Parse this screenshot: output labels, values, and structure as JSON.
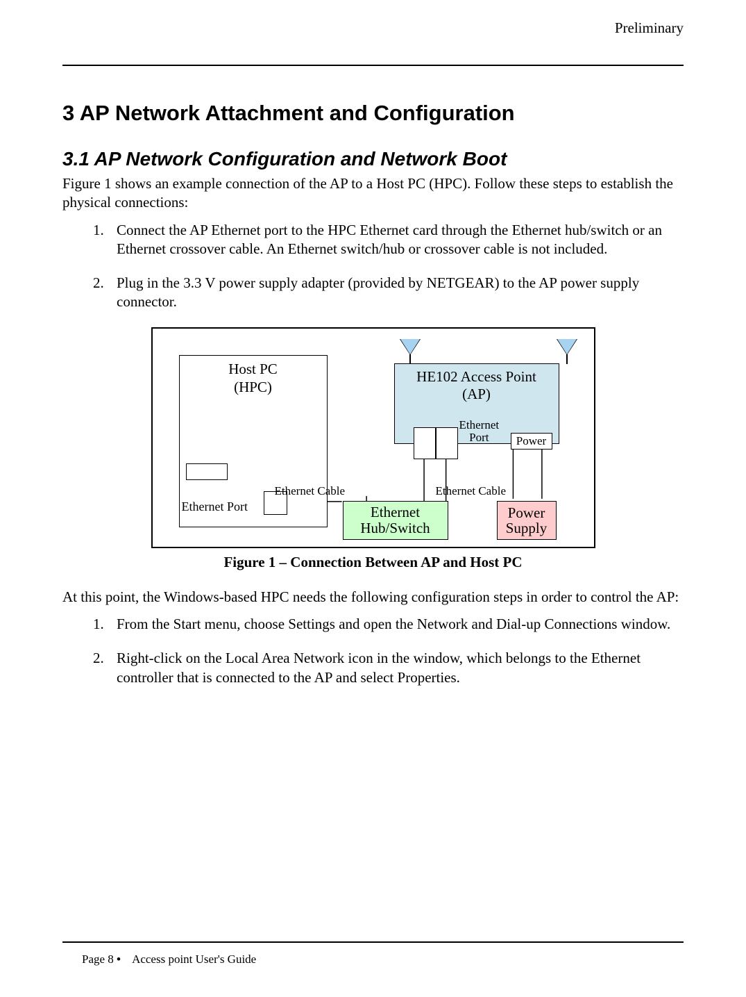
{
  "header": {
    "label": "Preliminary"
  },
  "section": {
    "h1": "3  AP Network Attachment and Configuration",
    "h2": "3.1    AP Network Configuration and Network Boot",
    "intro": "Figure 1 shows an example connection of the AP to a Host PC (HPC).  Follow these steps to establish the physical connections:",
    "steps_a": [
      "Connect the AP Ethernet port to the HPC Ethernet card through the Ethernet hub/switch or an Ethernet crossover cable. An Ethernet switch/hub or crossover cable is not included.",
      "Plug in the 3.3 V power supply adapter (provided by NETGEAR) to the AP power supply connector."
    ],
    "after_fig": "At this point, the Windows-based HPC needs the following configuration steps in order to control the AP:",
    "steps_b": [
      "From the Start menu, choose Settings and open the Network and Dial-up Connections window.",
      "Right-click on the Local Area Network icon in the window, which belongs to the Ethernet controller that is connected to the AP and select Properties."
    ]
  },
  "figure": {
    "hpc_line1": "Host PC",
    "hpc_line2": "(HPC)",
    "hpc_port": "Ethernet Port",
    "ap_line1": "HE102 Access Point",
    "ap_line2": "(AP)",
    "ap_eport_line1": "Ethernet",
    "ap_eport_line2": "Port",
    "ap_power": "Power",
    "hub_line1": "Ethernet",
    "hub_line2": "Hub/Switch",
    "psupply_line1": "Power",
    "psupply_line2": "Supply",
    "cable": "Ethernet Cable",
    "caption": "Figure 1 – Connection Between AP and Host PC"
  },
  "footer": {
    "page": "Page 8",
    "bullet": "•",
    "title": "Access point User's Guide"
  }
}
